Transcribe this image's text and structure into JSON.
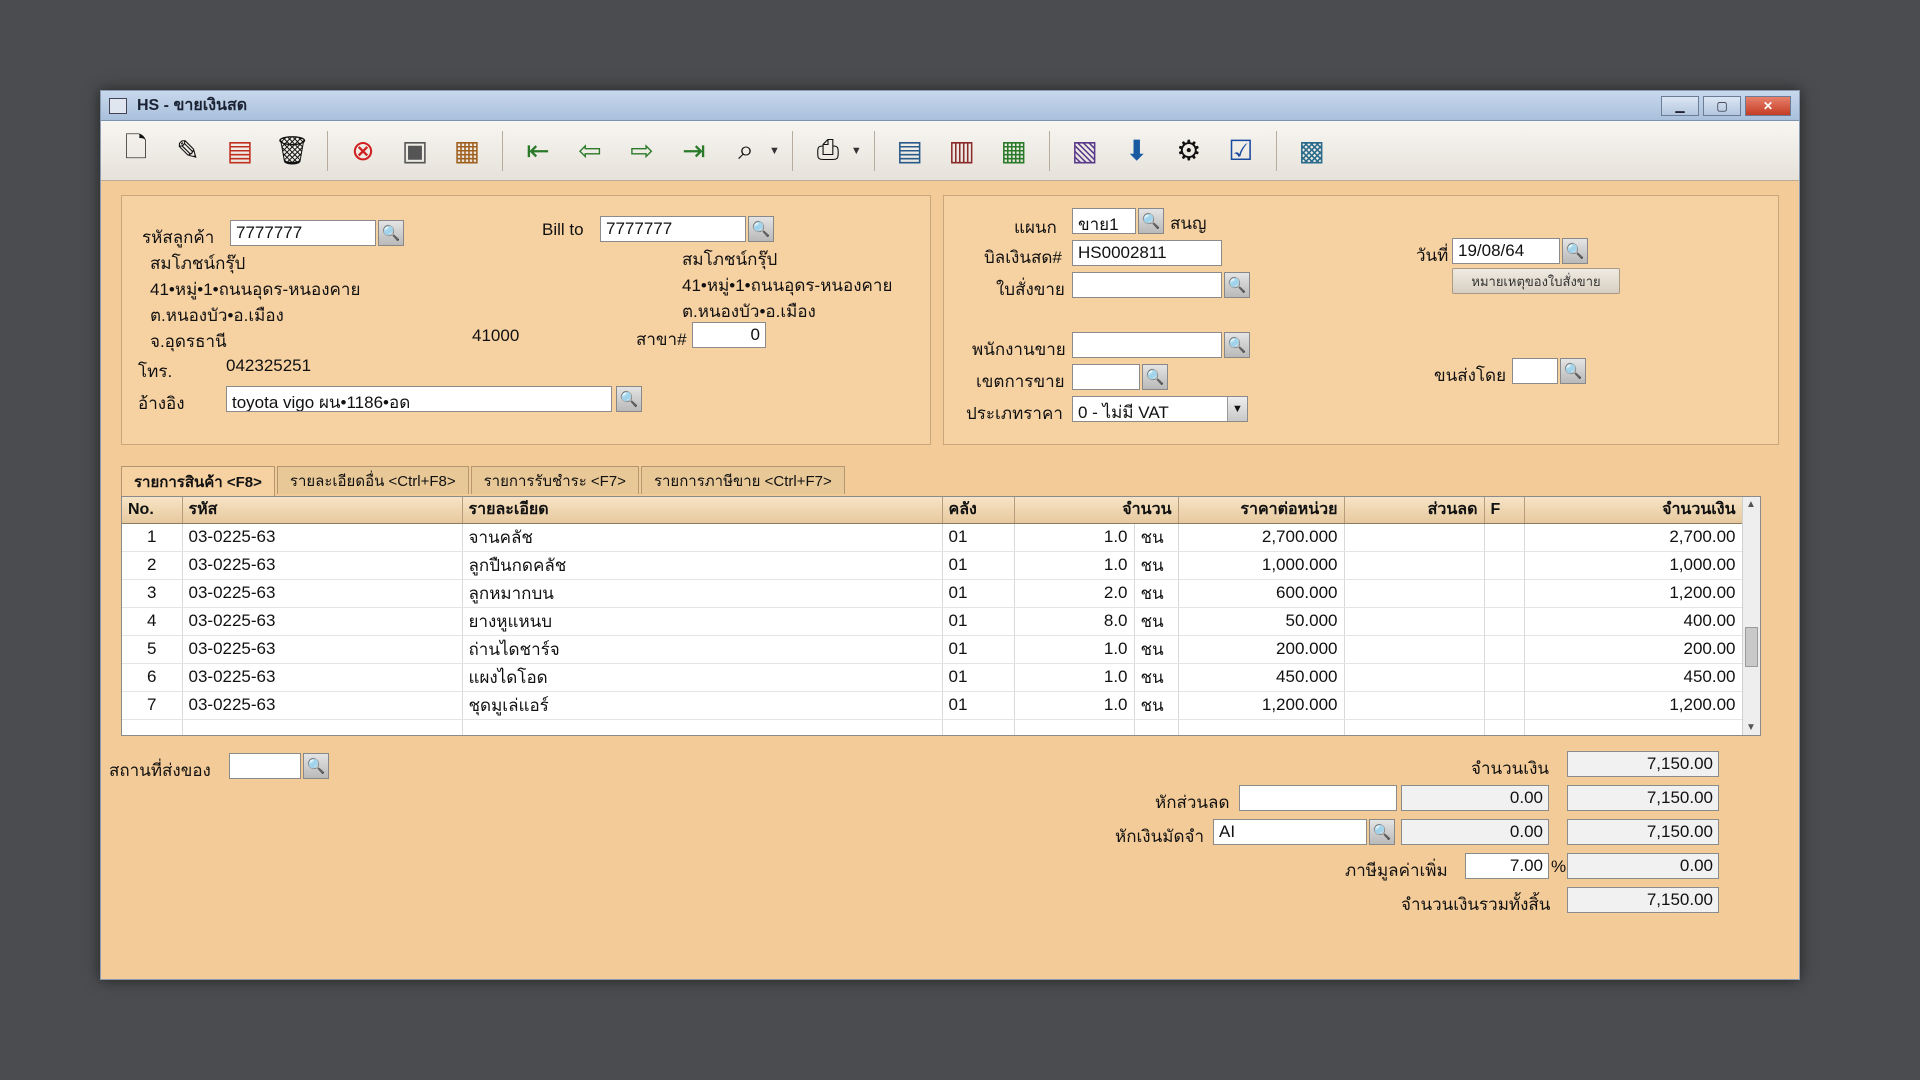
{
  "window": {
    "title": "HS - ขายเงินสด"
  },
  "toolbar": {
    "icons": [
      "new-doc-icon",
      "edit-icon",
      "cancel-doc-icon",
      "trash-icon",
      "close-icon",
      "save-icon",
      "books-icon",
      "first-icon",
      "prev-icon",
      "next-icon",
      "last-icon",
      "find-icon",
      "print-icon",
      "report1-icon",
      "report2-icon",
      "report3-icon",
      "report4-icon",
      "approve-icon",
      "tools-icon",
      "ok-icon",
      "calc-icon"
    ]
  },
  "customer": {
    "code_label": "รหัสลูกค้า",
    "code_value": "7777777",
    "name": "สมโภชน์กรุ๊ป",
    "addr1": "41•หมู่•1•ถนนอุดร-หนองคาย",
    "addr2": "ต.หนองบัว•อ.เมือง",
    "province": "จ.อุดรธานี",
    "postcode": "41000",
    "phone_label": "โทร.",
    "phone": "042325251",
    "ref_label": "อ้างอิง",
    "ref_value": "toyota vigo ผน•1186•อด"
  },
  "billto": {
    "label": "Bill to",
    "value": "7777777",
    "name": "สมโภชน์กรุ๊ป",
    "addr1": "41•หมู่•1•ถนนอุดร-หนองคาย",
    "addr2": "ต.หนองบัว•อ.เมือง",
    "branch_label": "สาขา#",
    "branch_value": "0"
  },
  "doc": {
    "dept_label": "แผนก",
    "dept_value": "ขาย1",
    "dept_name": "สนญ",
    "bill_label": "บิลเงินสด#",
    "bill_value": "HS0002811",
    "order_label": "ใบสั่งขาย",
    "order_value": "",
    "date_label": "วันที่",
    "date_value": "19/08/64",
    "note_button": "หมายเหตุของใบสั่งขาย",
    "salesman_label": "พนักงานขาย",
    "salesman_value": "",
    "area_label": "เขตการขาย",
    "area_value": "",
    "shipby_label": "ขนส่งโดย",
    "shipby_value": "",
    "pricetype_label": "ประเภทราคา",
    "pricetype_value": "0 - ไม่มี VAT"
  },
  "tabs": [
    {
      "label": "รายการสินค้า <F8>"
    },
    {
      "label": "รายละเอียดอื่น <Ctrl+F8>"
    },
    {
      "label": "รายการรับชำระ <F7>"
    },
    {
      "label": "รายการภาษีขาย <Ctrl+F7>"
    }
  ],
  "grid": {
    "headers": [
      "No.",
      "รหัส",
      "รายละเอียด",
      "คลัง",
      "จำนวน",
      "ราคาต่อหน่วย",
      "ส่วนลด",
      "F",
      "จำนวนเงิน"
    ],
    "rows": [
      {
        "no": "1",
        "code": "03-0225-63",
        "desc": "จานคลัช",
        "wh": "01",
        "qty": "1.0",
        "unit": "ชน",
        "price": "2,700.000",
        "disc": "",
        "f": "",
        "amount": "2,700.00"
      },
      {
        "no": "2",
        "code": "03-0225-63",
        "desc": "ลูกปืนกดคลัช",
        "wh": "01",
        "qty": "1.0",
        "unit": "ชน",
        "price": "1,000.000",
        "disc": "",
        "f": "",
        "amount": "1,000.00"
      },
      {
        "no": "3",
        "code": "03-0225-63",
        "desc": "ลูกหมากบน",
        "wh": "01",
        "qty": "2.0",
        "unit": "ชน",
        "price": "600.000",
        "disc": "",
        "f": "",
        "amount": "1,200.00"
      },
      {
        "no": "4",
        "code": "03-0225-63",
        "desc": "ยางหูแหนบ",
        "wh": "01",
        "qty": "8.0",
        "unit": "ชน",
        "price": "50.000",
        "disc": "",
        "f": "",
        "amount": "400.00"
      },
      {
        "no": "5",
        "code": "03-0225-63",
        "desc": "ถ่านไดชาร์จ",
        "wh": "01",
        "qty": "1.0",
        "unit": "ชน",
        "price": "200.000",
        "disc": "",
        "f": "",
        "amount": "200.00"
      },
      {
        "no": "6",
        "code": "03-0225-63",
        "desc": "แผงไดโอด",
        "wh": "01",
        "qty": "1.0",
        "unit": "ชน",
        "price": "450.000",
        "disc": "",
        "f": "",
        "amount": "450.00"
      },
      {
        "no": "7",
        "code": "03-0225-63",
        "desc": "ชุดมูเล่แอร์",
        "wh": "01",
        "qty": "1.0",
        "unit": "ชน",
        "price": "1,200.000",
        "disc": "",
        "f": "",
        "amount": "1,200.00"
      }
    ]
  },
  "footer": {
    "ship_label": "สถานที่ส่งของ",
    "ship_value": "",
    "amount_label": "จำนวนเงิน",
    "amount_value": "7,150.00",
    "discount_label": "หักส่วนลด",
    "discount_text": "",
    "discount_amount": "0.00",
    "after_discount": "7,150.00",
    "deposit_label": "หักเงินมัดจำ",
    "deposit_code": "AI",
    "deposit_amount": "0.00",
    "after_deposit": "7,150.00",
    "vat_label": "ภาษีมูลค่าเพิ่ม",
    "vat_rate": "7.00",
    "vat_pct": "%",
    "vat_amount": "0.00",
    "total_label": "จำนวนเงินรวมทั้งสิ้น",
    "total_value": "7,150.00"
  }
}
